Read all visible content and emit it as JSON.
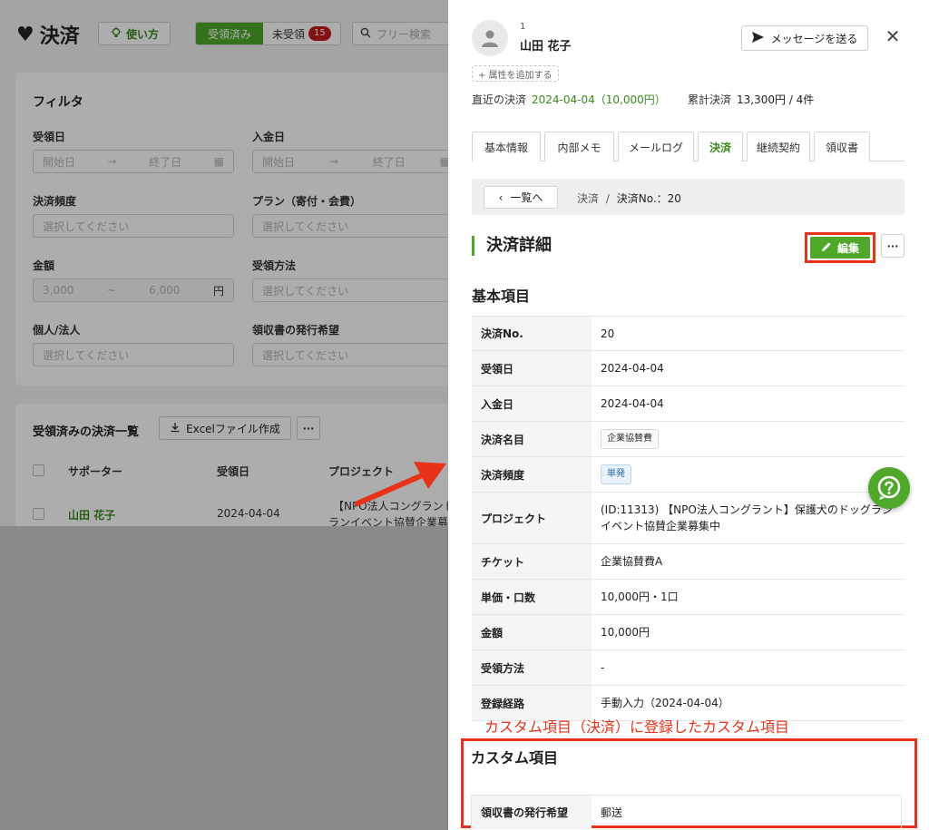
{
  "bg": {
    "page_title": "決済",
    "howto_label": "使い方",
    "seg_received": "受領済み",
    "seg_unreceived": "未受領",
    "unreceived_count": "15",
    "search_placeholder": "フリー検索",
    "filter": {
      "title": "フィルタ",
      "received_date_label": "受領日",
      "deposit_date_label": "入金日",
      "start_placeholder": "開始日",
      "end_placeholder": "終了日",
      "frequency_label": "決済頻度",
      "plan_label": "プラン（寄付・会費）",
      "select_placeholder": "選択してください",
      "amount_label": "金額",
      "amount_min": "3,000",
      "amount_max": "6,000",
      "amount_unit": "円",
      "method_label": "受領方法",
      "person_label": "個人/法人",
      "receipt_label": "領収書の発行希望"
    },
    "list": {
      "title": "受領済みの決済一覧",
      "excel_label": "Excelファイル作成",
      "col_supporter": "サポーター",
      "col_date": "受領日",
      "col_project": "プロジェクト",
      "row_name": "山田 花子",
      "row_date": "2024-04-04",
      "row_project_1": "【NPO法人コングラント】",
      "row_project_2": "ランイベント協賛企業募集"
    }
  },
  "drawer": {
    "supporter_id": "1",
    "supporter_name": "山田 花子",
    "message_label": "メッセージを送る",
    "add_attr_label": "+ 属性を追加する",
    "recent_label": "直近の決済",
    "recent_value": "2024-04-04（10,000円）",
    "total_label": "累計決済",
    "total_value": "13,300円 / 4件",
    "tabs": [
      "基本情報",
      "内部メモ",
      "メールログ",
      "決済",
      "継続契約",
      "領収書"
    ],
    "back_label": "一覧へ",
    "crumb_parent": "決済",
    "crumb_sep": "/",
    "crumb_current": "決済No.：20",
    "section_title": "決済詳細",
    "edit_label": "編集",
    "basic_title": "基本項目",
    "rows": {
      "no_k": "決済No.",
      "no_v": "20",
      "recv_k": "受領日",
      "recv_v": "2024-04-04",
      "dep_k": "入金日",
      "dep_v": "2024-04-04",
      "name_k": "決済名目",
      "name_v": "企業協賛費",
      "freq_k": "決済頻度",
      "freq_v": "単発",
      "proj_k": "プロジェクト",
      "proj_v": "(ID:11313) 【NPO法人コングラント】保護犬のドッグランイベント協賛企業募集中",
      "ticket_k": "チケット",
      "ticket_v": "企業協賛費A",
      "unit_k": "単価・口数",
      "unit_v": "10,000円・1口",
      "amt_k": "金額",
      "amt_v": "10,000円",
      "method_k": "受領方法",
      "method_v": "-",
      "route_k": "登録経路",
      "route_v": "手動入力（2024-04-04）"
    },
    "annotation": "カスタム項目（決済）に登録したカスタム項目",
    "custom_title": "カスタム項目",
    "custom_k": "領収書の発行希望",
    "custom_v": "郵送"
  },
  "colors": {
    "brand_green": "#4fa82a",
    "annotation_red": "#e8331a",
    "badge_red": "#c21a1a"
  }
}
